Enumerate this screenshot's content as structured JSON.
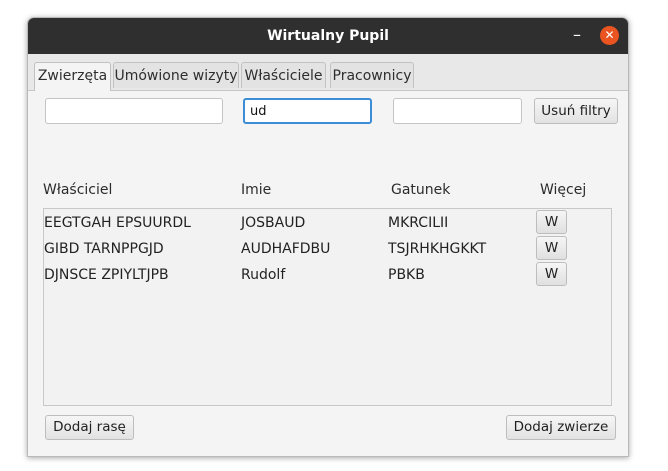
{
  "window": {
    "title": "Wirtualny Pupil",
    "min_glyph": "–",
    "close_glyph": "✕"
  },
  "tabs": [
    {
      "label": "Zwierzęta",
      "active": true
    },
    {
      "label": "Umówione wizyty",
      "active": false
    },
    {
      "label": "Właściciele",
      "active": false
    },
    {
      "label": "Pracownicy",
      "active": false
    }
  ],
  "filters": {
    "owner_value": "",
    "name_value": "ud",
    "species_value": "",
    "clear_label": "Usuń filtry"
  },
  "table": {
    "headers": {
      "owner": "Właściciel",
      "name": "Imie",
      "species": "Gatunek",
      "more": "Więcej"
    },
    "rows": [
      {
        "owner": "EEGTGAH EPSUURDL",
        "name": "JOSBAUD",
        "species": "MKRCILII",
        "more_label": "W"
      },
      {
        "owner": "GIBD TARNPPGJD",
        "name": "AUDHAFDBU",
        "species": "TSJRHKHGKKT",
        "more_label": "W"
      },
      {
        "owner": "DJNSCE ZPIYLTJPB",
        "name": "Rudolf",
        "species": "PBKB",
        "more_label": "W"
      }
    ]
  },
  "footer": {
    "add_breed_label": "Dodaj rasę",
    "add_animal_label": "Dodaj zwierze"
  },
  "colors": {
    "titlebar": "#2f2f2f",
    "close": "#e95420",
    "focus": "#3c8cd6"
  }
}
